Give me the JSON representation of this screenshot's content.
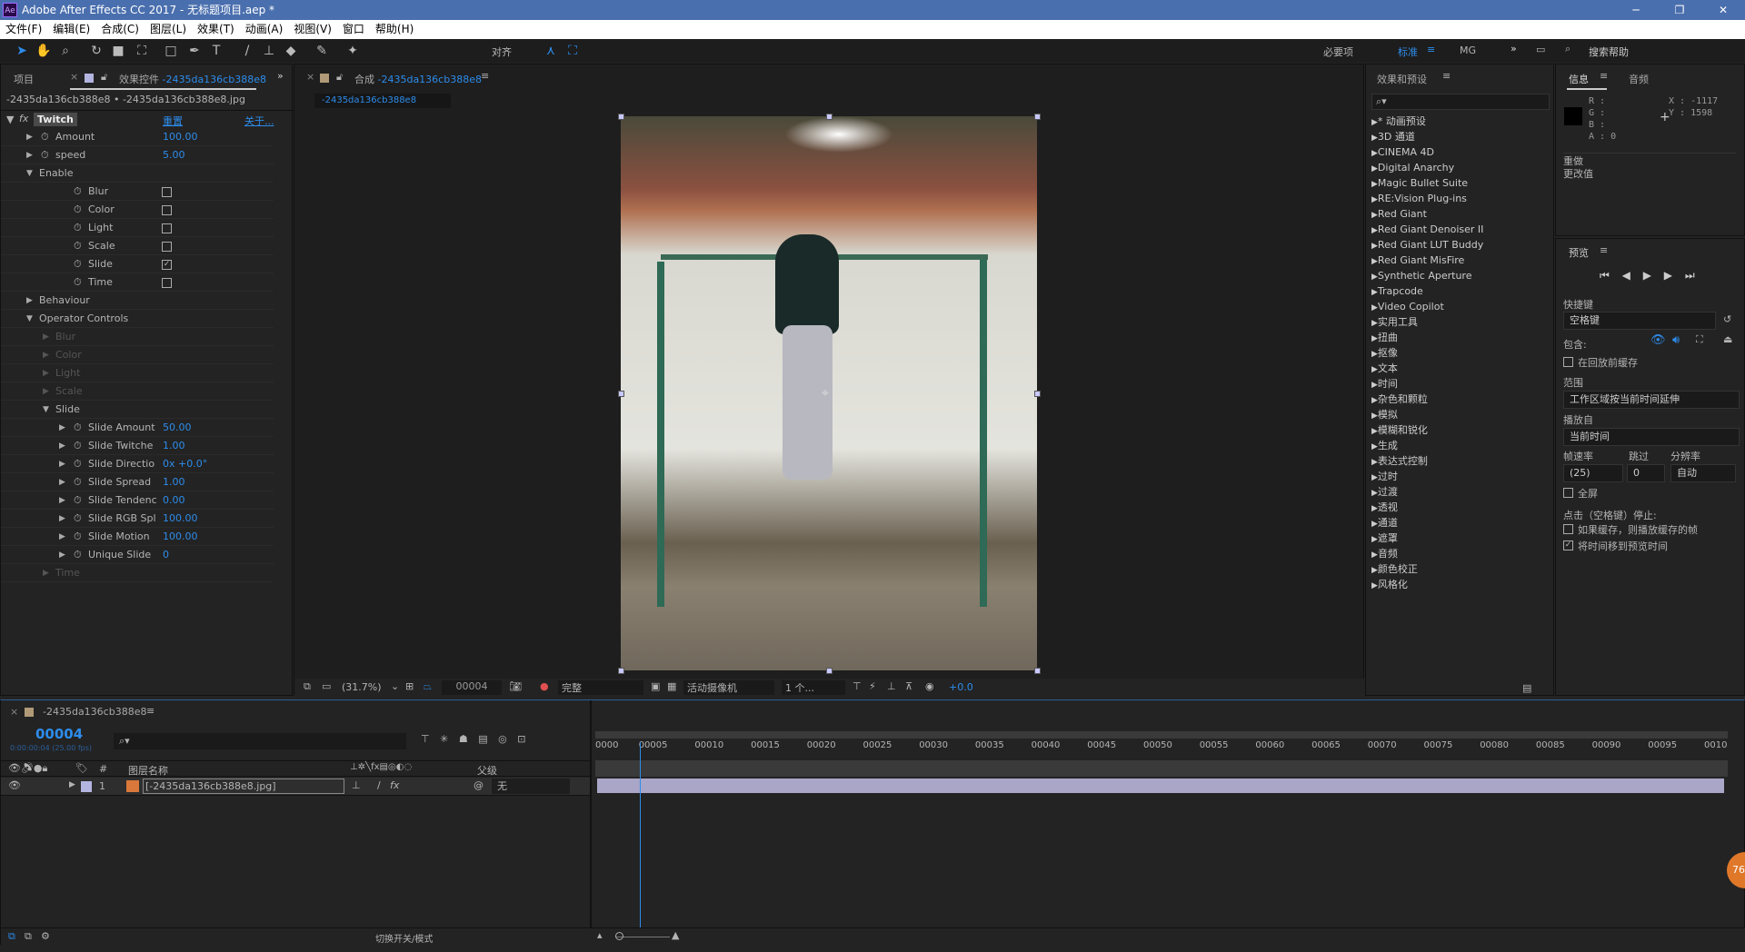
{
  "window": {
    "title": "Adobe After Effects CC 2017 - 无标题项目.aep *",
    "logo": "Ae"
  },
  "menu": [
    "文件(F)",
    "编辑(E)",
    "合成(C)",
    "图层(L)",
    "效果(T)",
    "动画(A)",
    "视图(V)",
    "窗口",
    "帮助(H)"
  ],
  "toolbar": {
    "align_label": "对齐",
    "workspaces": [
      "必要项",
      "标准",
      "MG"
    ],
    "search_placeholder": "搜索帮助"
  },
  "left_panel": {
    "tab_project": "项目",
    "tab_effects": "效果控件",
    "tab_effects_target": "-2435da136cb388e8",
    "breadcrumb": "-2435da136cb388e8 • -2435da136cb388e8.jpg",
    "effect_name": "Twitch",
    "reset": "重置",
    "about": "关于...",
    "rows": [
      {
        "label": "Amount",
        "value": "100.00",
        "indent": 1,
        "type": "val",
        "arrow": "▶",
        "stopwatch": true
      },
      {
        "label": "speed",
        "value": "5.00",
        "indent": 1,
        "type": "val",
        "arrow": "▶",
        "stopwatch": true
      },
      {
        "label": "Enable",
        "indent": 1,
        "type": "group",
        "arrow": "▼"
      },
      {
        "label": "Blur",
        "indent": 3,
        "type": "check",
        "checked": false,
        "stopwatch": true
      },
      {
        "label": "Color",
        "indent": 3,
        "type": "check",
        "checked": false,
        "stopwatch": true
      },
      {
        "label": "Light",
        "indent": 3,
        "type": "check",
        "checked": false,
        "stopwatch": true
      },
      {
        "label": "Scale",
        "indent": 3,
        "type": "check",
        "checked": false,
        "stopwatch": true
      },
      {
        "label": "Slide",
        "indent": 3,
        "type": "check",
        "checked": true,
        "stopwatch": true
      },
      {
        "label": "Time",
        "indent": 3,
        "type": "check",
        "checked": false,
        "stopwatch": true
      },
      {
        "label": "Behaviour",
        "indent": 1,
        "type": "group",
        "arrow": "▶"
      },
      {
        "label": "Operator Controls",
        "indent": 1,
        "type": "group",
        "arrow": "▼"
      },
      {
        "label": "Blur",
        "indent": 2,
        "type": "dim",
        "arrow": "▶"
      },
      {
        "label": "Color",
        "indent": 2,
        "type": "dim",
        "arrow": "▶"
      },
      {
        "label": "Light",
        "indent": 2,
        "type": "dim",
        "arrow": "▶"
      },
      {
        "label": "Scale",
        "indent": 2,
        "type": "dim",
        "arrow": "▶"
      },
      {
        "label": "Slide",
        "indent": 2,
        "type": "group",
        "arrow": "▼"
      },
      {
        "label": "Slide Amount",
        "value": "50.00",
        "indent": 3,
        "type": "val",
        "arrow": "▶",
        "stopwatch": true
      },
      {
        "label": "Slide Twitche",
        "value": "1.00",
        "indent": 3,
        "type": "val",
        "arrow": "▶",
        "stopwatch": true
      },
      {
        "label": "Slide Directio",
        "value": "0x +0.0°",
        "indent": 3,
        "type": "val",
        "arrow": "▶",
        "stopwatch": true
      },
      {
        "label": "Slide Spread",
        "value": "1.00",
        "indent": 3,
        "type": "val",
        "arrow": "▶",
        "stopwatch": true
      },
      {
        "label": "Slide Tendenc",
        "value": "0.00",
        "indent": 3,
        "type": "val",
        "arrow": "▶",
        "stopwatch": true
      },
      {
        "label": "Slide RGB Spl",
        "value": "100.00",
        "indent": 3,
        "type": "val",
        "arrow": "▶",
        "stopwatch": true
      },
      {
        "label": "Slide Motion",
        "value": "100.00",
        "indent": 3,
        "type": "val",
        "arrow": "▶",
        "stopwatch": true
      },
      {
        "label": "Unique Slide",
        "value": "0",
        "indent": 3,
        "type": "val",
        "arrow": "▶",
        "stopwatch": true
      },
      {
        "label": "Time",
        "indent": 2,
        "type": "dim",
        "arrow": "▶"
      }
    ]
  },
  "comp": {
    "tab": "合成",
    "tab_target": "-2435da136cb388e8",
    "subtab": "-2435da136cb388e8",
    "bottom": {
      "zoom": "(31.7%)",
      "frame": "00004",
      "resolution": "完整",
      "camera": "活动摄像机",
      "views": "1 个...",
      "exposure": "+0.0"
    }
  },
  "effects_panel": {
    "title": "效果和预设",
    "items": [
      "* 动画预设",
      "3D 通道",
      "CINEMA 4D",
      "Digital Anarchy",
      "Magic Bullet Suite",
      "RE:Vision Plug-ins",
      "Red Giant",
      "Red Giant Denoiser II",
      "Red Giant LUT Buddy",
      "Red Giant MisFire",
      "Synthetic Aperture",
      "Trapcode",
      "Video Copilot",
      "实用工具",
      "扭曲",
      "抠像",
      "文本",
      "时间",
      "杂色和颗粒",
      "模拟",
      "模糊和锐化",
      "生成",
      "表达式控制",
      "过时",
      "过渡",
      "透视",
      "通道",
      "遮罩",
      "音频",
      "颜色校正",
      "风格化"
    ]
  },
  "info": {
    "tab_info": "信息",
    "tab_audio": "音频",
    "r": "R :",
    "g": "G :",
    "b": "B :",
    "a": "A : 0",
    "x": "X : -1117",
    "y": "Y : 1598",
    "undo1": "重做",
    "undo2": "更改值",
    "swatch": "#000000"
  },
  "preview": {
    "title": "预览",
    "shortcut_label": "快捷键",
    "shortcut": "空格键",
    "include_label": "包含:",
    "cache_label": "在回放前缓存",
    "range_label": "范围",
    "range": "工作区域按当前时间延伸",
    "play_from_label": "播放自",
    "play_from": "当前时间",
    "fps_label": "帧速率",
    "skip_label": "跳过",
    "res_label": "分辨率",
    "fps": "(25)",
    "skip": "0",
    "res": "自动",
    "fullscreen": "全屏",
    "stop_label": "点击（空格键）停止:",
    "opt1": "如果缓存，则播放缓存的帧",
    "opt2": "将时间移到预览时间",
    "opt1_checked": false,
    "opt2_checked": true
  },
  "timeline": {
    "tab": "-2435da136cb388e8",
    "timecode": "00004",
    "timecode_sub": "0:00:00:04 (25.00 fps)",
    "col_layer_name": "图层名称",
    "col_num": "#",
    "col_parent": "父级",
    "layers": [
      {
        "num": "1",
        "name": "[-2435da136cb388e8.jpg]",
        "parent": "无",
        "color": "#b4b4e0"
      }
    ],
    "ruler": [
      "0000",
      "00005",
      "00010",
      "00015",
      "00020",
      "00025",
      "00030",
      "00035",
      "00040",
      "00045",
      "00050",
      "00055",
      "00060",
      "00065",
      "00070",
      "00075",
      "00080",
      "00085",
      "00090",
      "00095",
      "0010"
    ],
    "current_frame": 4,
    "total_frames": 100,
    "toggle_label": "切换开关/模式"
  },
  "colors": {
    "accent": "#2d8ceb",
    "layer_bar": "#a9a6c8",
    "title_bar": "#4a6fae"
  }
}
